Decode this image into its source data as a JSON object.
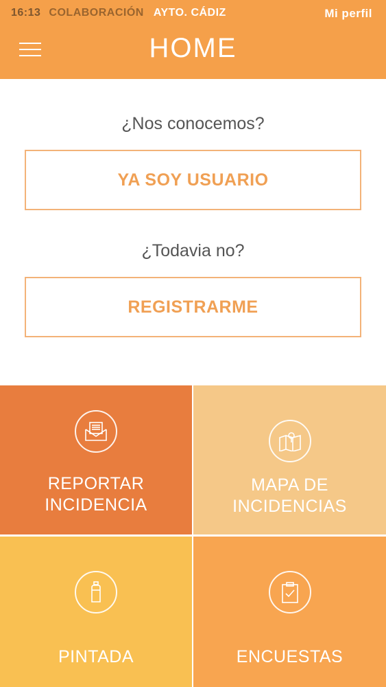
{
  "status_bar": {
    "time": "16:13",
    "carrier": "COLABORACIÓN",
    "org": "AYTO. CÁDIZ",
    "profile_link": "Mi perfil"
  },
  "header": {
    "title": "HOME",
    "menu_icon": "hamburger-menu-icon"
  },
  "auth": {
    "question_existing": "¿Nos conocemos?",
    "login_label": "YA SOY USUARIO",
    "question_new": "¿Todavia no?",
    "register_label": "REGISTRARME"
  },
  "tiles": [
    {
      "label_line1": "REPORTAR",
      "label_line2": "INCIDENCIA",
      "icon": "envelope-document-icon",
      "color": "#e87d3e"
    },
    {
      "label_line1": "MAPA DE",
      "label_line2": "INCIDENCIAS",
      "icon": "map-pin-icon",
      "color": "#f5c888"
    },
    {
      "label_line1": "PINTADA",
      "icon": "spray-can-icon",
      "color": "#f9c052"
    },
    {
      "label_line1": "ENCUESTAS",
      "icon": "clipboard-check-icon",
      "color": "#f8a550"
    }
  ],
  "colors": {
    "header": "#f5a04a",
    "accent": "#f0a054",
    "button_border": "#f3b278"
  }
}
